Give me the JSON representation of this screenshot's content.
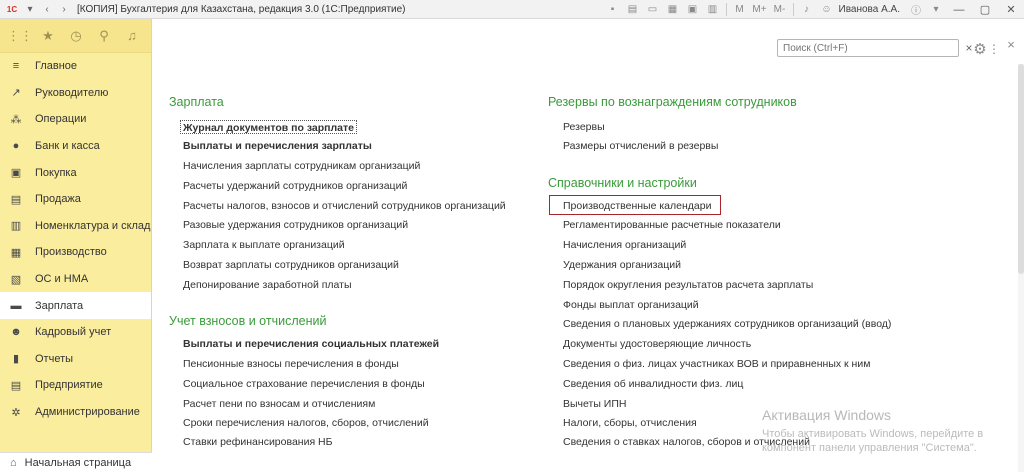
{
  "titlebar": {
    "title": "[КОПИЯ] Бухгалтерия для Казахстана, редакция 3.0  (1С:Предприятие)",
    "zoom_m": "M",
    "zoom_mplus": "M+",
    "zoom_mminus": "M-",
    "user": "Иванова А.А."
  },
  "sidebar": {
    "items": [
      {
        "label": "Главное",
        "icon": "≡"
      },
      {
        "label": "Руководителю",
        "icon": "↗"
      },
      {
        "label": "Операции",
        "icon": "⁂"
      },
      {
        "label": "Банк и касса",
        "icon": "●"
      },
      {
        "label": "Покупка",
        "icon": "▣"
      },
      {
        "label": "Продажа",
        "icon": "▤"
      },
      {
        "label": "Номенклатура и склад",
        "icon": "▥"
      },
      {
        "label": "Производство",
        "icon": "▦"
      },
      {
        "label": "ОС и НМА",
        "icon": "▧"
      },
      {
        "label": "Зарплата",
        "icon": "▬"
      },
      {
        "label": "Кадровый учет",
        "icon": "☻"
      },
      {
        "label": "Отчеты",
        "icon": "▮"
      },
      {
        "label": "Предприятие",
        "icon": "▤"
      },
      {
        "label": "Администрирование",
        "icon": "✲"
      }
    ],
    "home_tab": "Начальная страница"
  },
  "search": {
    "placeholder": "Поиск (Ctrl+F)"
  },
  "left_column": {
    "salary": {
      "title": "Зарплата",
      "links": [
        "Журнал документов по зарплате",
        "Выплаты и перечисления зарплаты",
        "Начисления зарплаты сотрудникам организаций",
        "Расчеты удержаний сотрудников организаций",
        "Расчеты налогов, взносов и отчислений сотрудников организаций",
        "Разовые удержания сотрудников организаций",
        "Зарплата к выплате организаций",
        "Возврат зарплаты сотрудников организаций",
        "Депонирование заработной платы"
      ]
    },
    "contributions": {
      "title": "Учет взносов и отчислений",
      "links": [
        "Выплаты и перечисления социальных платежей",
        "Пенсионные взносы перечисления в фонды",
        "Социальное страхование перечисления в фонды",
        "Расчет пени по взносам и отчислениям",
        "Сроки перечисления налогов, сборов, отчислений",
        "Ставки рефинансирования НБ"
      ]
    }
  },
  "right_column": {
    "reserves": {
      "title": "Резервы по вознаграждениям сотрудников",
      "links": [
        "Резервы",
        "Размеры отчислений в резервы"
      ]
    },
    "settings": {
      "title": "Справочники и настройки",
      "links": [
        "Производственные календари",
        "Регламентированные расчетные показатели",
        "Начисления организаций",
        "Удержания организаций",
        "Порядок округления результатов расчета зарплаты",
        "Фонды выплат организаций",
        "Сведения о плановых удержаниях сотрудников организаций (ввод)",
        "Документы удостоверяющие личность",
        "Сведения о физ. лицах участниках ВОВ и приравненных к ним",
        "Сведения об инвалидности физ. лиц",
        "Вычеты ИПН",
        "Налоги, сборы, отчисления",
        "Сведения о ставках налогов, сборов и отчислений"
      ]
    }
  },
  "watermark": {
    "title": "Активация Windows",
    "line1": "Чтобы активировать Windows, перейдите в",
    "line2": "компонент панели управления \"Система\"."
  }
}
